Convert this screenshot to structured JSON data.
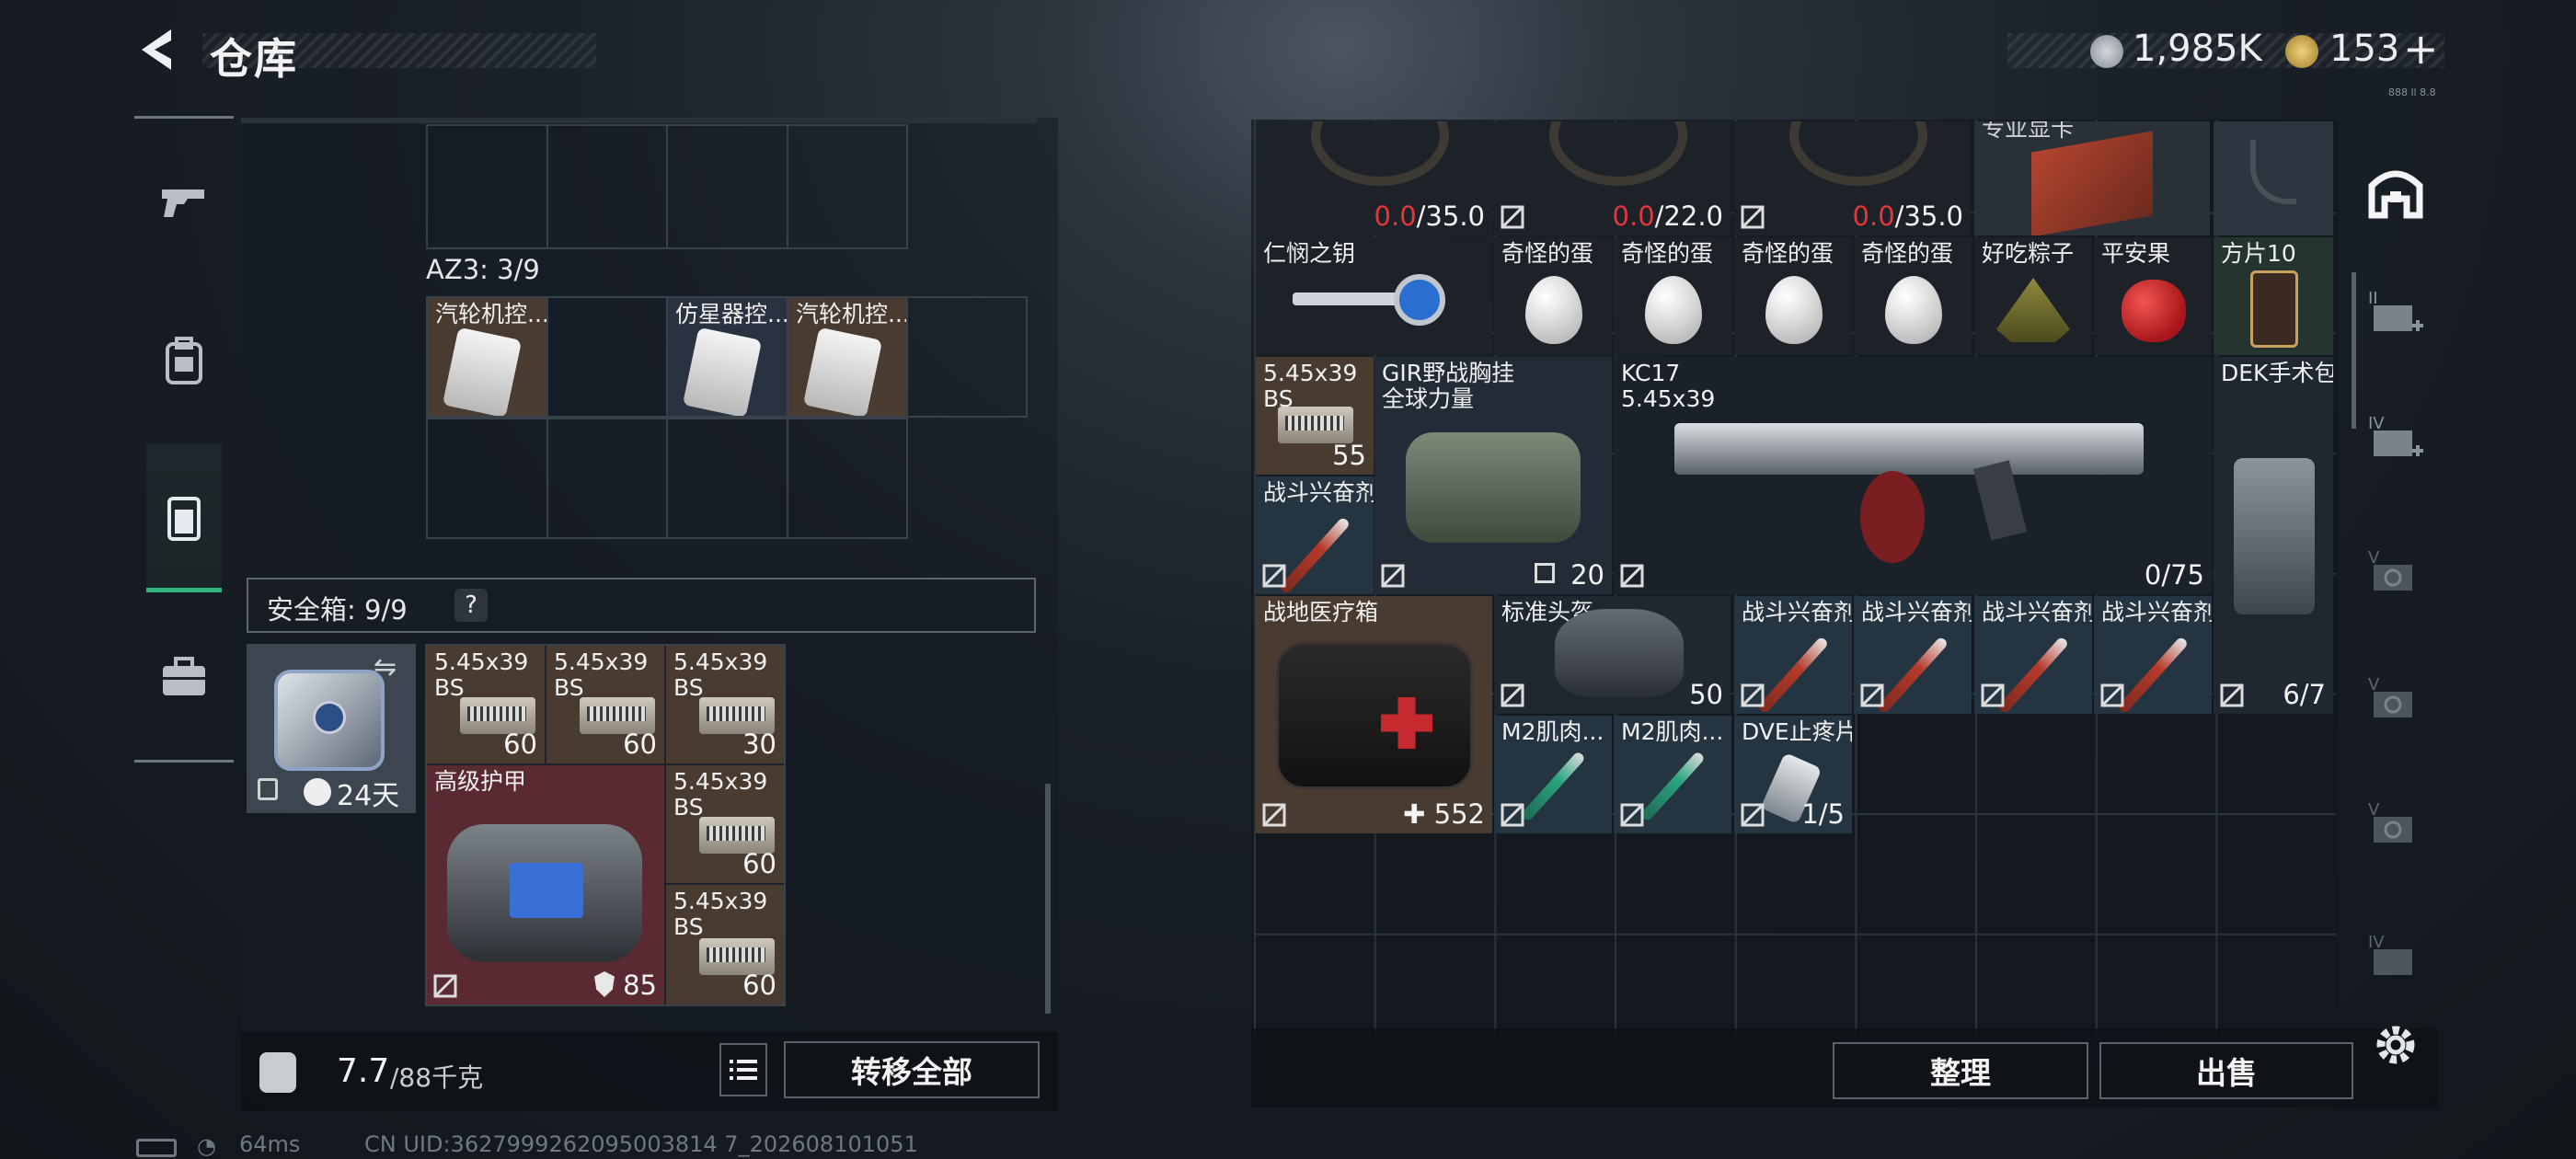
{
  "header": {
    "title": "仓库",
    "back_icon": "back-arrow-icon"
  },
  "currency": {
    "silver": "1,985K",
    "gold": "153",
    "add_label": "+"
  },
  "version": "888 ll 8.8",
  "nav": {
    "items": [
      {
        "name": "weapon",
        "icon": "pistol-icon"
      },
      {
        "name": "gear",
        "icon": "backpack-icon"
      },
      {
        "name": "vest",
        "icon": "vest-icon",
        "active": true
      },
      {
        "name": "case",
        "icon": "briefcase-icon"
      }
    ]
  },
  "left": {
    "az3_label": "AZ3: 3/9",
    "az3_items": [
      "汽轮机控...",
      "仿星器控...",
      "汽轮机控..."
    ],
    "safebox_label": "安全箱: 9/9",
    "safebox_help": "?",
    "safebox_timer": "24天",
    "safebox_items": [
      {
        "name": "5.45x39\nBS",
        "count": "60"
      },
      {
        "name": "5.45x39\nBS",
        "count": "60"
      },
      {
        "name": "5.45x39\nBS",
        "count": "30"
      },
      {
        "name": "高级护甲",
        "count": "85"
      },
      {
        "name": "5.45x39\nBS",
        "count": "60"
      },
      {
        "name": "5.45x39\nBS",
        "count": "60"
      }
    ],
    "weight_current": "7.7",
    "weight_max": "/88千克",
    "transfer_all": "转移全部"
  },
  "right": {
    "top_row": [
      {
        "dur": "0.0",
        "max": "/35.0"
      },
      {
        "dur": "0.0",
        "max": "/22.0"
      },
      {
        "dur": "0.0",
        "max": "/35.0"
      },
      {
        "name": "专业显卡"
      }
    ],
    "row2": [
      "仁悯之钥",
      "奇怪的蛋",
      "奇怪的蛋",
      "奇怪的蛋",
      "奇怪的蛋",
      "好吃粽子",
      "平安果",
      "方片10"
    ],
    "ammo_name": "5.45x39\nBS",
    "ammo_count": "55",
    "vest_name": "GIR野战胸挂\n全球力量",
    "vest_count": "20",
    "gun_name": "KC17\n5.45x39",
    "gun_count": "0/75",
    "surgical": "DEK手术包",
    "surgical_count": "6/7",
    "stim_label": "战斗兴奋剂",
    "medkit": "战地医疗箱",
    "medkit_count": "552",
    "helmet": "标准头盔",
    "helmet_count": "50",
    "stims": [
      "战斗兴奋剂",
      "战斗兴奋剂",
      "战斗兴奋剂",
      "战斗兴奋剂"
    ],
    "row5": [
      {
        "name": "M2肌肉..."
      },
      {
        "name": "M2肌肉..."
      },
      {
        "name": "DVE止疼片",
        "count": "1/5"
      }
    ],
    "sort": "整理",
    "sell": "出售"
  },
  "side": {
    "items": [
      "home-icon",
      "ii-case-icon",
      "iv-case-icon",
      "v-case-icon",
      "v-case-icon",
      "v-case-icon",
      "iv-case-icon"
    ],
    "settings": "gear-icon"
  },
  "status": {
    "ping": "64ms",
    "uid": "CN UID:3627999262095003814 7_202608101051"
  }
}
